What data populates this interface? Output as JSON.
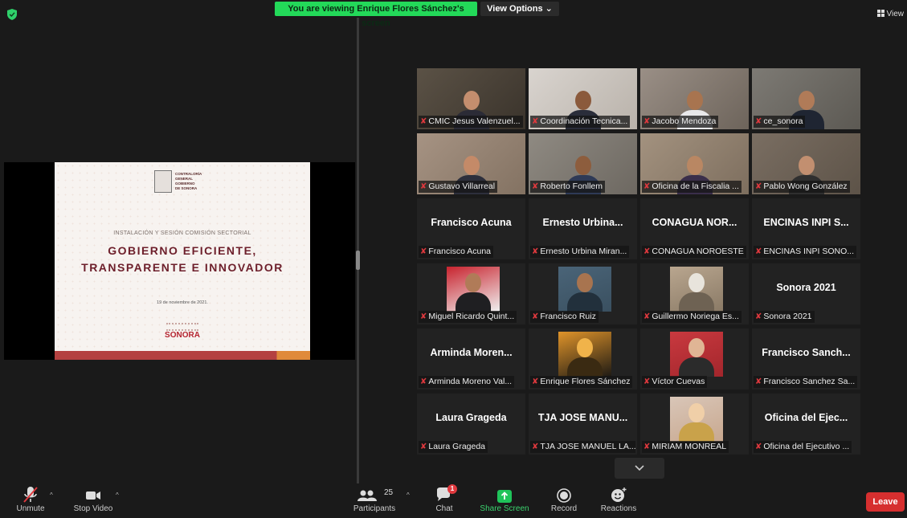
{
  "banner": {
    "viewing": "You are viewing Enrique Flores Sánchez's screen",
    "view_options": "View Options ⌄"
  },
  "top_right": {
    "view_label": "View"
  },
  "slide": {
    "logo_text": [
      "CONTRALORÍA",
      "GENERAL",
      "GOBIERNO",
      "DE SONORA"
    ],
    "subtitle": "INSTALACIÓN Y SESIÓN COMISIÓN SECTORIAL",
    "title_line1": "GOBIERNO EFICIENTE,",
    "title_line2": "TRANSPARENTE E INNOVADOR",
    "date": "19 de noviembre de 2021.",
    "brand": "SONORA"
  },
  "gallery": [
    {
      "label": "CMIC Jesus Valenzuel...",
      "center": "",
      "type": "photo"
    },
    {
      "label": "Coordinación Tecnica...",
      "center": "",
      "type": "photo"
    },
    {
      "label": "Jacobo Mendoza",
      "center": "",
      "type": "photo"
    },
    {
      "label": "ce_sonora",
      "center": "",
      "type": "photo"
    },
    {
      "label": "Gustavo Villarreal",
      "center": "",
      "type": "photo"
    },
    {
      "label": "Roberto Fonllem",
      "center": "",
      "type": "photo"
    },
    {
      "label": "Oficina de la Fiscalia ...",
      "center": "",
      "type": "photo"
    },
    {
      "label": "Pablo Wong González",
      "center": "",
      "type": "photo"
    },
    {
      "label": "Francisco Acuna",
      "center": "Francisco Acuna",
      "type": "name"
    },
    {
      "label": "Ernesto Urbina Miran...",
      "center": "Ernesto Urbina...",
      "type": "name"
    },
    {
      "label": "CONAGUA NOROESTE",
      "center": "CONAGUA NOR...",
      "type": "name"
    },
    {
      "label": "ENCINAS INPI SONO...",
      "center": "ENCINAS INPI S...",
      "type": "name"
    },
    {
      "label": "Miguel Ricardo Quint...",
      "center": "",
      "type": "inset"
    },
    {
      "label": "Francisco Ruiz",
      "center": "",
      "type": "inset"
    },
    {
      "label": "Guillermo Noriega Es...",
      "center": "",
      "type": "inset"
    },
    {
      "label": "Sonora 2021",
      "center": "Sonora 2021",
      "type": "name"
    },
    {
      "label": "Arminda Moreno Val...",
      "center": "Arminda Moren...",
      "type": "name"
    },
    {
      "label": "Enrique Flores Sánchez",
      "center": "",
      "type": "inset"
    },
    {
      "label": "Víctor Cuevas",
      "center": "",
      "type": "inset"
    },
    {
      "label": "Francisco Sanchez Sa...",
      "center": "Francisco Sanch...",
      "type": "name"
    },
    {
      "label": "Laura Grageda",
      "center": "Laura Grageda",
      "type": "name"
    },
    {
      "label": "TJA JOSE MANUEL LA...",
      "center": "TJA JOSE MANU...",
      "type": "name"
    },
    {
      "label": "MIRIAM MONREAL",
      "center": "",
      "type": "inset"
    },
    {
      "label": "Oficina del Ejecutivo ...",
      "center": "Oficina del Ejec...",
      "type": "name"
    }
  ],
  "toolbar": {
    "unmute": "Unmute",
    "stop_video": "Stop Video",
    "participants": "Participants",
    "participants_count": "25",
    "chat": "Chat",
    "chat_badge": "1",
    "share_screen": "Share Screen",
    "record": "Record",
    "reactions": "Reactions",
    "leave": "Leave"
  },
  "colors": {
    "banner_green": "#23d959",
    "share_green": "#1fc45a",
    "leave_red": "#d62f2f",
    "muted_red": "#e0393e",
    "active_speaker": "#c8d64a"
  }
}
